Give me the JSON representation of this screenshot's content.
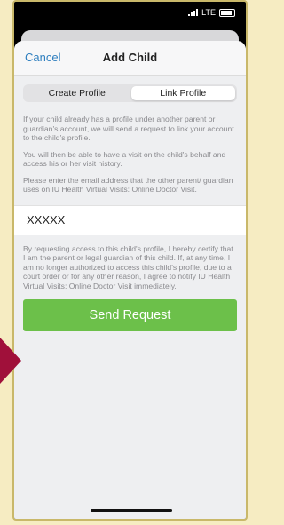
{
  "status_bar": {
    "network": "LTE"
  },
  "nav": {
    "cancel_label": "Cancel",
    "title": "Add Child"
  },
  "segments": [
    {
      "label": "Create Profile",
      "selected": false
    },
    {
      "label": "Link Profile",
      "selected": true
    }
  ],
  "body": {
    "paragraph_1": "If your child already has a profile under another parent or guardian's account, we will send a request to link your account to the child's profile.",
    "paragraph_2": "You will then be able to have a visit on the child's behalf and access his or her visit history.",
    "paragraph_3": "Please enter the email address that the other parent/ guardian uses on IU Health Virtual Visits: Online Doctor Visit.",
    "email_value": "XXXXX",
    "certification": "By requesting access to this child's profile, I hereby certify that I am the parent or legal guardian of this child. If, at any time, I am no longer authorized to access this child's profile, due to a court order or for any other reason, I agree to notify IU Health Virtual Visits: Online Doctor Visit immediately."
  },
  "send_button_label": "Send Request",
  "colors": {
    "accent_blue": "#2f7fbf",
    "send_green": "#6cc04a",
    "pointer_red": "#a0103a",
    "frame_bg": "#f6ecc2"
  }
}
